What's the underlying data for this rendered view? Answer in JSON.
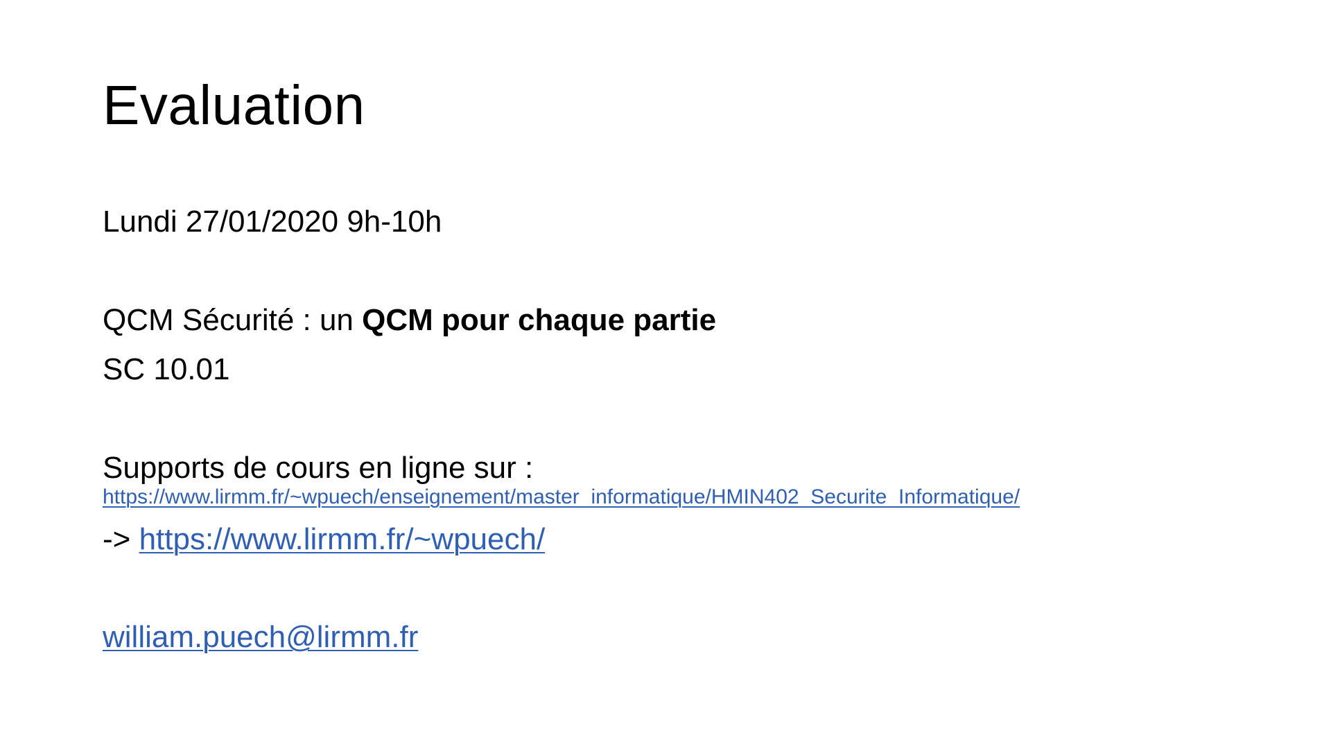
{
  "slide": {
    "title": "Evaluation",
    "date_line": "Lundi 27/01/2020 9h-10h",
    "qcm": {
      "prefix": "QCM Sécurité : un ",
      "bold": "QCM pour chaque partie"
    },
    "room": "SC 10.01",
    "supports_label": "Supports de cours en ligne sur :",
    "course_url": "https://www.lirmm.fr/~wpuech/enseignement/master_informatique/HMIN402_Securite_Informatique/",
    "arrow_prefix": "-> ",
    "home_url": "https://www.lirmm.fr/~wpuech/",
    "email": "william.puech@lirmm.fr"
  },
  "colors": {
    "text": "#000000",
    "link": "#2f5fb3",
    "background": "#ffffff"
  }
}
